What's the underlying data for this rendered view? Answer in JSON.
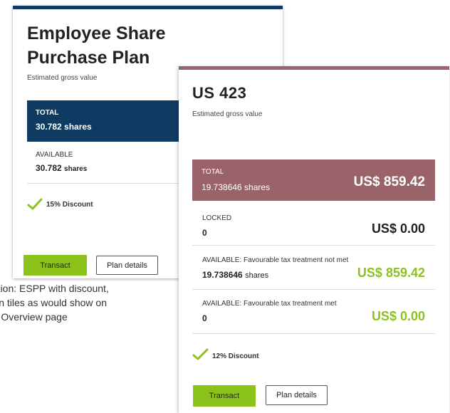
{
  "plan_card": {
    "title": "Employee Share Purchase Plan",
    "subtitle": "Estimated gross value",
    "total_label": "TOTAL",
    "total_value": "30.782 shares",
    "available_label": "AVAILABLE",
    "available_number": "30.782",
    "available_unit": "shares",
    "discount": "15% Discount",
    "transact_label": "Transact",
    "plan_details_label": "Plan details",
    "accent_color": "#0f3b63"
  },
  "caption": {
    "line1": "Option: ESPP with discount,",
    "line2": "Plan tiles as would show on",
    "line3": "the Overview page"
  },
  "value_card": {
    "amount": "US 423",
    "subtitle": "Estimated gross value",
    "total_label": "TOTAL",
    "total_value": "19.738646 shares",
    "total_amount": "US$ 859.42",
    "locked_label": "LOCKED",
    "locked_value": "0",
    "locked_amount": "US$ 0.00",
    "avail_not_met_label_prefix": "AVAILABLE:",
    "avail_not_met_label_text": " Favourable tax treatment not met",
    "avail_not_met_number": "19.738646",
    "avail_not_met_unit": "shares",
    "avail_not_met_amount": "US$ 859.42",
    "avail_met_label_prefix": "AVAILABLE:",
    "avail_met_label_text": " Favourable tax treatment met",
    "avail_met_value": "0",
    "avail_met_amount": "US$ 0.00",
    "discount": "12% Discount",
    "transact_label": "Transact",
    "plan_details_label": "Plan details",
    "accent_color": "#9a6369",
    "green_color": "#8cc21c"
  },
  "icons": {
    "discount_check": "check-icon"
  }
}
